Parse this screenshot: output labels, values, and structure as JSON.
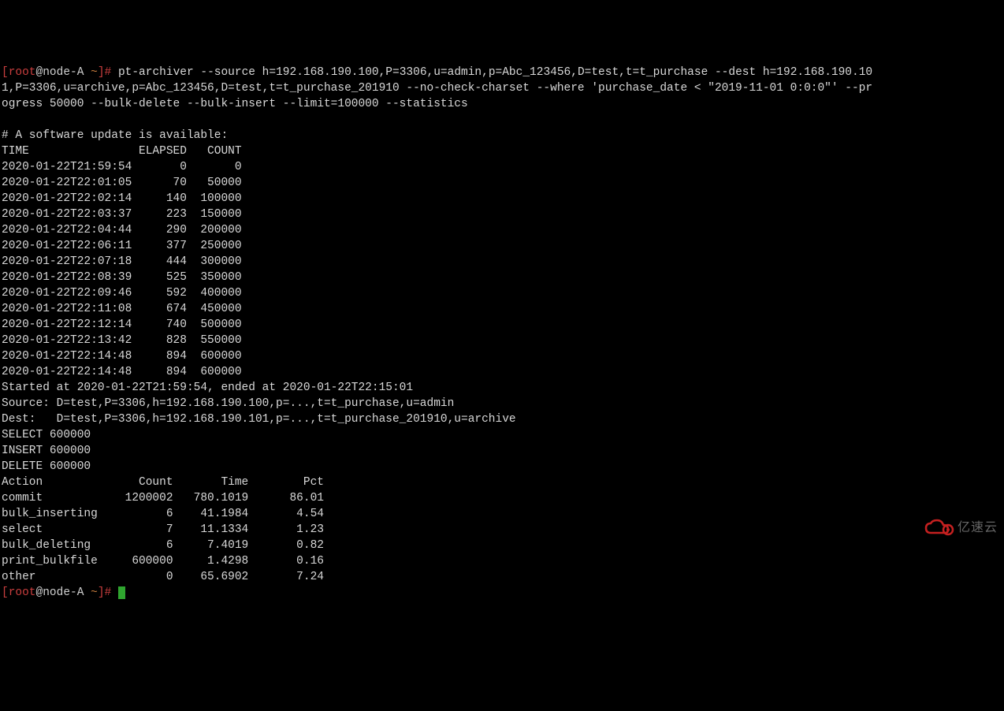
{
  "prompt": {
    "user": "root",
    "host": "node-A",
    "cwd": "~",
    "open": "[",
    "at": "@",
    "close": "]#"
  },
  "command": {
    "line1": " pt-archiver --source h=192.168.190.100,P=3306,u=admin,p=Abc_123456,D=test,t=t_purchase --dest h=192.168.190.10",
    "line2": "1,P=3306,u=archive,p=Abc_123456,D=test,t=t_purchase_201910 --no-check-charset --where 'purchase_date < \"2019-11-01 0:0:0\"' --pr",
    "line3": "ogress 50000 --bulk-delete --bulk-insert --limit=100000 --statistics"
  },
  "update_msg": "# A software update is available:",
  "progress_header": "TIME                ELAPSED   COUNT",
  "progress_rows": [
    "2020-01-22T21:59:54       0       0",
    "2020-01-22T22:01:05      70   50000",
    "2020-01-22T22:02:14     140  100000",
    "2020-01-22T22:03:37     223  150000",
    "2020-01-22T22:04:44     290  200000",
    "2020-01-22T22:06:11     377  250000",
    "2020-01-22T22:07:18     444  300000",
    "2020-01-22T22:08:39     525  350000",
    "2020-01-22T22:09:46     592  400000",
    "2020-01-22T22:11:08     674  450000",
    "2020-01-22T22:12:14     740  500000",
    "2020-01-22T22:13:42     828  550000",
    "2020-01-22T22:14:48     894  600000",
    "2020-01-22T22:14:48     894  600000"
  ],
  "summary": {
    "started": "Started at 2020-01-22T21:59:54, ended at 2020-01-22T22:15:01",
    "source": "Source: D=test,P=3306,h=192.168.190.100,p=...,t=t_purchase,u=admin",
    "dest": "Dest:   D=test,P=3306,h=192.168.190.101,p=...,t=t_purchase_201910,u=archive",
    "select": "SELECT 600000",
    "insert": "INSERT 600000",
    "delete": "DELETE 600000"
  },
  "stats_header": "Action              Count       Time        Pct",
  "stats_rows": [
    "commit            1200002   780.1019      86.01",
    "bulk_inserting          6    41.1984       4.54",
    "select                  7    11.1334       1.23",
    "bulk_deleting           6     7.4019       0.82",
    "print_bulkfile     600000     1.4298       0.16",
    "other                   0    65.6902       7.24"
  ],
  "logo_text": "亿速云"
}
